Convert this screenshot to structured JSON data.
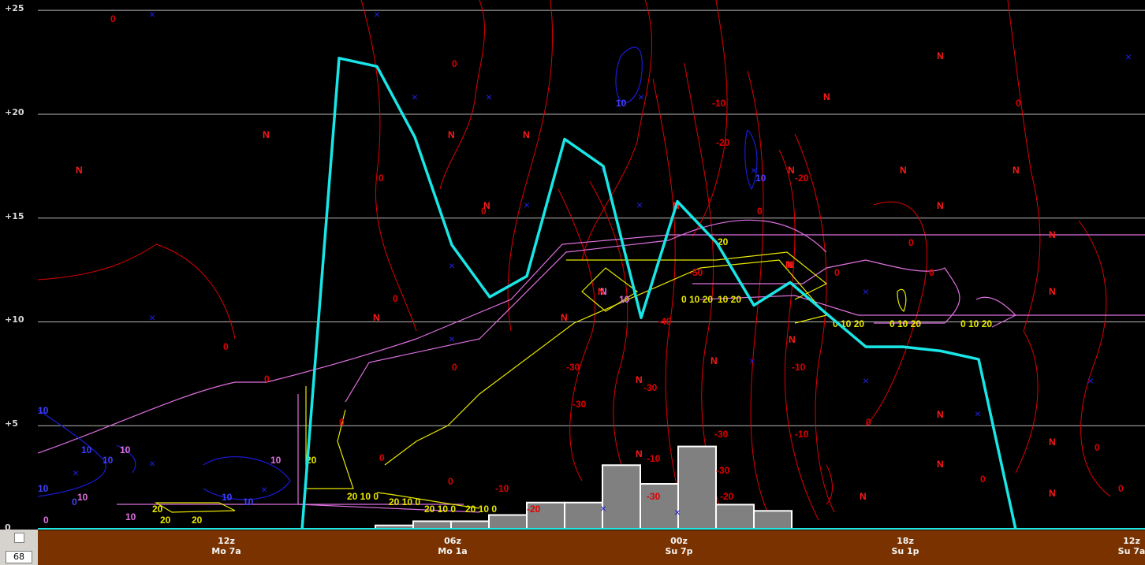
{
  "y_axis": {
    "ticks": [
      "+25",
      "+20",
      "+15",
      "+10",
      "+5",
      "0"
    ]
  },
  "time_axis": [
    {
      "time": "12z",
      "day": "Mo 7a"
    },
    {
      "time": "06z",
      "day": "Mo 1a"
    },
    {
      "time": "00z",
      "day": "Su 7p"
    },
    {
      "time": "18z",
      "day": "Su 1p"
    },
    {
      "time": "12z",
      "day": "Su 7a"
    }
  ],
  "controls": {
    "value": "68"
  },
  "colors": {
    "background": "#000000",
    "cyan_line": "#19e6e6",
    "bars": "#808080",
    "time_bar": "#7a3300",
    "contour_red": "#e00000",
    "contour_yellow": "#e8e800",
    "contour_violet": "#e070e0",
    "contour_blue": "#1a1ad8"
  },
  "chart_data": {
    "type": "line",
    "ylim": [
      0,
      25.5
    ],
    "grid": true,
    "series": [
      {
        "values": [
          0,
          22.7,
          22.3,
          18.9,
          13.7,
          11.2,
          12.2,
          18.8,
          17.5,
          10.2,
          15.8,
          13.8,
          10.8,
          11.9,
          10.3,
          8.8,
          8.8,
          8.6,
          8.2,
          0
        ]
      }
    ],
    "bars": [
      0.2,
      0.4,
      0.4,
      0.7,
      1.3,
      1.3,
      3.1,
      2.2,
      4.0,
      1.2,
      0.9
    ],
    "contour_labels": {
      "red": [
        "0",
        "0",
        "0",
        "0",
        "0",
        "0",
        "0",
        "0",
        "0",
        "0",
        "0",
        "0",
        "0",
        "0",
        "0",
        "0",
        "0",
        "0",
        "0",
        "0",
        "-10",
        "-20",
        "-20",
        "-30",
        "-30",
        "-40",
        "-50",
        "-30",
        "-30",
        "-30",
        "-20",
        "-10",
        "-10",
        "-10",
        "-20",
        "-10",
        "-30"
      ],
      "yellow": [
        "20",
        "20",
        "20",
        "20",
        "20",
        "10 20",
        "20 10 0",
        "20 10 0",
        "20 10 0",
        "20 10 0",
        "0 10 20",
        "0 10 20",
        "0 10 20",
        "0 10 20"
      ],
      "violet": [
        "10",
        "10",
        "10",
        "10",
        "0",
        "10",
        "N"
      ],
      "blue": [
        "10",
        "10",
        "10",
        "10",
        "0",
        "10",
        "10",
        "10",
        "10"
      ],
      "n_markers": [
        "N",
        "N",
        "N",
        "N",
        "N",
        "N",
        "N",
        "N",
        "N",
        "N",
        "N",
        "N",
        "N",
        "N",
        "N",
        "N",
        "N",
        "N",
        "N",
        "N",
        "N",
        "N",
        "N",
        "N",
        "N",
        "N",
        "N",
        "N"
      ]
    }
  }
}
